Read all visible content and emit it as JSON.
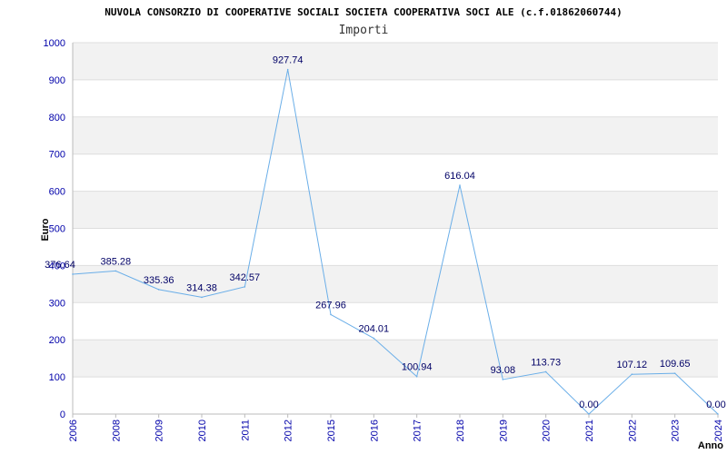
{
  "chart_data": {
    "type": "line",
    "title": "NUVOLA CONSORZIO DI COOPERATIVE SOCIALI SOCIETA COOPERATIVA SOCI ALE (c.f.01862060744)",
    "subtitle": "Importi",
    "xlabel": "Anno",
    "ylabel": "Euro",
    "ylim": [
      0,
      1000
    ],
    "yticks": [
      "0",
      "100",
      "200",
      "300",
      "400",
      "500",
      "600",
      "700",
      "800",
      "900",
      "1000"
    ],
    "categories": [
      "2006",
      "2008",
      "2009",
      "2010",
      "2011",
      "2012",
      "2015",
      "2016",
      "2017",
      "2018",
      "2019",
      "2020",
      "2021",
      "2022",
      "2023",
      "2024"
    ],
    "values": [
      376.64,
      385.28,
      335.36,
      314.38,
      342.57,
      927.74,
      267.96,
      204.01,
      100.94,
      616.04,
      93.08,
      113.73,
      0.0,
      107.12,
      109.65,
      0.0
    ],
    "value_labels": [
      "376.64",
      "385.28",
      "335.36",
      "314.38",
      "342.57",
      "927.74",
      "267.96",
      "204.01",
      "100.94",
      "616.04",
      "93.08",
      "113.73",
      "0.00",
      "107.12",
      "109.65",
      "0.00"
    ],
    "grid": true,
    "colors": {
      "line": "#6aaee8",
      "band": "#f2f2f2",
      "grid": "#dddddd",
      "tick_text": "#0000aa",
      "label_text": "#000066"
    }
  }
}
